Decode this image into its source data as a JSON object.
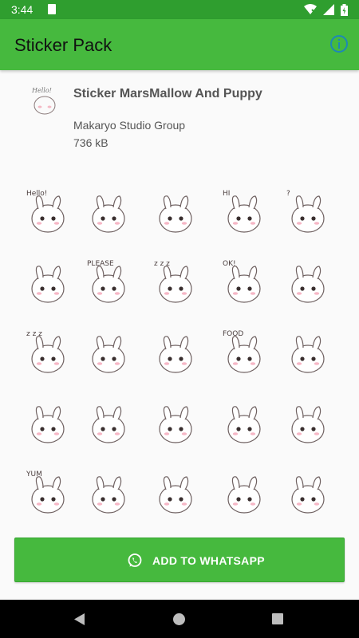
{
  "status_bar": {
    "time": "3:44"
  },
  "app_bar": {
    "title": "Sticker Pack",
    "info_icon": "info-icon"
  },
  "pack": {
    "name": "Sticker MarsMallow And Puppy",
    "publisher": "Makaryo Studio Group",
    "size": "736 kB",
    "tray_text": "Hello!"
  },
  "stickers": [
    {
      "text": "Hello!"
    },
    {
      "text": ""
    },
    {
      "text": ""
    },
    {
      "text": "HI"
    },
    {
      "text": "?"
    },
    {
      "text": ""
    },
    {
      "text": "PLEASE"
    },
    {
      "text": "z z z"
    },
    {
      "text": "OK!"
    },
    {
      "text": ""
    },
    {
      "text": "z z z"
    },
    {
      "text": ""
    },
    {
      "text": ""
    },
    {
      "text": "FOOD"
    },
    {
      "text": ""
    },
    {
      "text": ""
    },
    {
      "text": ""
    },
    {
      "text": ""
    },
    {
      "text": ""
    },
    {
      "text": ""
    },
    {
      "text": "YUM"
    },
    {
      "text": ""
    },
    {
      "text": ""
    },
    {
      "text": ""
    },
    {
      "text": ""
    }
  ],
  "add_button": {
    "label": "ADD TO WHATSAPP",
    "icon": "whatsapp-icon"
  },
  "colors": {
    "status_bar": "#2f9e2f",
    "app_bar": "#46b93e",
    "accent_info": "#1e88b5",
    "button": "#46b93e"
  }
}
